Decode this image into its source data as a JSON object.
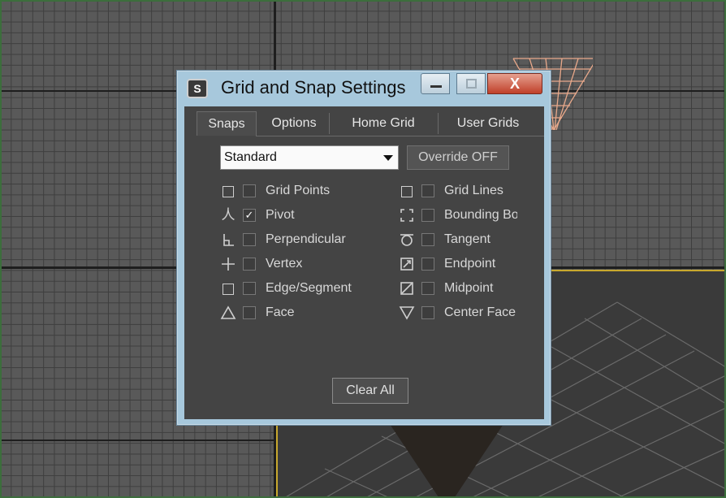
{
  "dialog": {
    "title": "Grid and Snap Settings",
    "app_icon": "S",
    "close_glyph": "X",
    "tabs": [
      {
        "label": "Snaps",
        "active": true
      },
      {
        "label": "Options",
        "active": false
      },
      {
        "label": "Home Grid",
        "active": false
      },
      {
        "label": "User Grids",
        "active": false
      }
    ],
    "dropdown": {
      "value": "Standard"
    },
    "override_label": "Override OFF",
    "snaps_left": [
      {
        "label": "Grid Points",
        "icon": "grid-points-icon",
        "checked": false
      },
      {
        "label": "Pivot",
        "icon": "pivot-icon",
        "checked": true
      },
      {
        "label": "Perpendicular",
        "icon": "perpendicular-icon",
        "checked": false
      },
      {
        "label": "Vertex",
        "icon": "vertex-icon",
        "checked": false
      },
      {
        "label": "Edge/Segment",
        "icon": "edge-segment-icon",
        "checked": false
      },
      {
        "label": "Face",
        "icon": "face-icon",
        "checked": false
      }
    ],
    "snaps_right": [
      {
        "label": "Grid Lines",
        "icon": "grid-lines-icon",
        "checked": false
      },
      {
        "label": "Bounding Bo",
        "icon": "bounding-box-icon",
        "checked": false
      },
      {
        "label": "Tangent",
        "icon": "tangent-icon",
        "checked": false
      },
      {
        "label": "Endpoint",
        "icon": "endpoint-icon",
        "checked": false
      },
      {
        "label": "Midpoint",
        "icon": "midpoint-icon",
        "checked": false
      },
      {
        "label": "Center Face",
        "icon": "center-face-icon",
        "checked": false
      }
    ],
    "clear_all_label": "Clear All"
  },
  "colors": {
    "titlebar": "#a7c8dc",
    "client_bg": "#444444",
    "close_button": "#c0402a",
    "viewport_highlight": "#c8a82e"
  }
}
